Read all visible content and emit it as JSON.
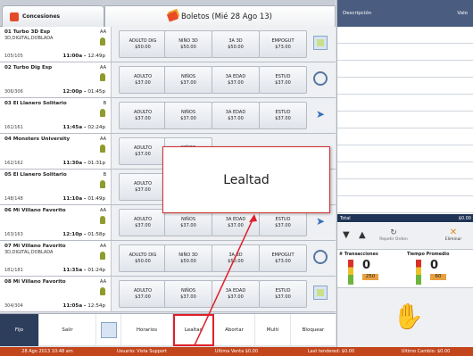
{
  "tabs": {
    "concesiones": "Concesiones",
    "boletos": "Boletos (Mié 28 Ago 13)"
  },
  "movies": [
    {
      "title": "01 Turbo 3D Esp",
      "format": "3D,DIGITAL,DOBLADA",
      "rating": "AA",
      "seats": "105/105",
      "time": "11:00a",
      "end": "12:49p",
      "prices": [
        [
          "ADULTO DIG",
          "$50.00"
        ],
        [
          "NIÑO 3D",
          "$50.00"
        ],
        [
          "3A 3D",
          "$50.00"
        ],
        [
          "EMPOGUT",
          "$73.00"
        ]
      ],
      "icon": "calendar-icon"
    },
    {
      "title": "02 Turbo Dig Esp",
      "format": "",
      "rating": "AA",
      "seats": "306/306",
      "time": "12:00p",
      "end": "01:45p",
      "prices": [
        [
          "ADULTO",
          "$37.00"
        ],
        [
          "NIÑOS",
          "$37.00"
        ],
        [
          "3A EDAD",
          "$37.00"
        ],
        [
          "ESTUD",
          "$37.00"
        ]
      ],
      "icon": "refresh-icon"
    },
    {
      "title": "03 El Llanero Solitario",
      "format": "",
      "rating": "B",
      "seats": "161/161",
      "time": "11:45a",
      "end": "02:24p",
      "prices": [
        [
          "ADULTO",
          "$37.00"
        ],
        [
          "NIÑOS",
          "$37.00"
        ],
        [
          "3A EDAD",
          "$37.00"
        ],
        [
          "ESTUD",
          "$37.00"
        ]
      ],
      "icon": "arrow-icon"
    },
    {
      "title": "04 Monsters University",
      "format": "",
      "rating": "AA",
      "seats": "162/162",
      "time": "11:30a",
      "end": "01:31p",
      "prices": [
        [
          "ADULTO",
          "$37.00"
        ],
        [
          "NIÑOS",
          "$37.00"
        ],
        [
          "",
          ""
        ],
        [
          "",
          ""
        ]
      ],
      "icon": ""
    },
    {
      "title": "05 El Llanero Solitario",
      "format": "",
      "rating": "B",
      "seats": "148/148",
      "time": "11:10a",
      "end": "01:49p",
      "prices": [
        [
          "ADULTO",
          "$37.00"
        ],
        [
          "NIÑOS",
          "$37.00"
        ],
        [
          "",
          ""
        ],
        [
          "",
          ""
        ]
      ],
      "icon": ""
    },
    {
      "title": "06 Mi Villano Favorito",
      "format": "",
      "rating": "AA",
      "seats": "163/163",
      "time": "12:10p",
      "end": "01:58p",
      "prices": [
        [
          "ADULTO",
          "$37.00"
        ],
        [
          "NIÑOS",
          "$37.00"
        ],
        [
          "3A EDAD",
          "$37.00"
        ],
        [
          "ESTUD",
          "$37.00"
        ]
      ],
      "icon": "arrow-icon"
    },
    {
      "title": "07 Mi Villano Favorito",
      "format": "3D,DIGITAL,DOBLADA",
      "rating": "AA",
      "seats": "181/181",
      "time": "11:35a",
      "end": "01:24p",
      "prices": [
        [
          "ADULTO DIG",
          "$50.00"
        ],
        [
          "NIÑO 3D",
          "$50.00"
        ],
        [
          "3A 3D",
          "$50.00"
        ],
        [
          "EMPOGUT",
          "$73.00"
        ]
      ],
      "icon": "refresh-icon"
    },
    {
      "title": "08 Mi Villano Favorito",
      "format": "",
      "rating": "AA",
      "seats": "304/304",
      "time": "11:05a",
      "end": "12:54p",
      "prices": [
        [
          "ADULTO",
          "$37.00"
        ],
        [
          "NIÑOS",
          "$37.00"
        ],
        [
          "3A EDAD",
          "$37.00"
        ],
        [
          "ESTUD",
          "$37.00"
        ]
      ],
      "icon": "calendar-icon"
    }
  ],
  "toolbar": {
    "fijo": "Fijo",
    "salir": "Salir",
    "horarios": "Horarios",
    "lealtad": "Lealtad",
    "abortar": "Abortar",
    "multi": "Multi",
    "bloquear": "Bloquear"
  },
  "popup": {
    "text": "Lealtad"
  },
  "right": {
    "col_desc": "Descripción",
    "col_val": "Valo",
    "total_label": "Total",
    "total_value": "$0.00",
    "repetir": "Repetir Orden",
    "eliminar": "Eliminar",
    "transacciones_title": "# Transacciones",
    "transacciones_value": "0",
    "transacciones_target": "250",
    "promedio_title": "Tiempo Promedio",
    "promedio_value": "0",
    "promedio_target": "60"
  },
  "status": {
    "date": "28 Ago 2013 10:48 am",
    "user": "Usuario: Vista Support",
    "ultima": "Última Venta $0.00",
    "tendered": "Last tendered: $0.00",
    "cambio": "Último Cambio: $0.00"
  }
}
